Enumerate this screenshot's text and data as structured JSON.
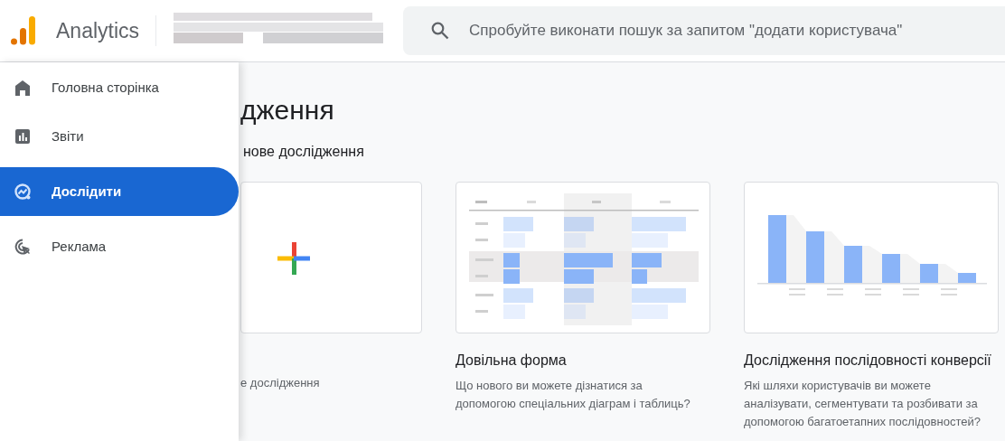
{
  "app": {
    "title": "Analytics"
  },
  "search": {
    "placeholder": "Спробуйте виконати пошук за запитом \"додати користувача\""
  },
  "nav": [
    {
      "kind": "home",
      "label": "Головна сторінка",
      "selected": false
    },
    {
      "kind": "reports",
      "label": "Звіти",
      "selected": false
    },
    {
      "kind": "explore",
      "label": "Дослідити",
      "selected": true
    },
    {
      "kind": "ads",
      "label": "Реклама",
      "selected": false
    }
  ],
  "page": {
    "title": "дження",
    "subtitle": "нове дослідження"
  },
  "cards": [
    {
      "kind": "blank",
      "description": "е дослідження"
    },
    {
      "kind": "table",
      "title": "Довільна форма",
      "description": "Що нового ви можете дізнатися за допомогою спеціальних діаграм і таблиць?"
    },
    {
      "kind": "funnel",
      "title": "Дослідження послідовності конверсії",
      "description": "Які шляхи користувачів ви можете аналізувати, сегментувати та розбивати за допомогою багатоетапних послідовностей?"
    }
  ]
}
